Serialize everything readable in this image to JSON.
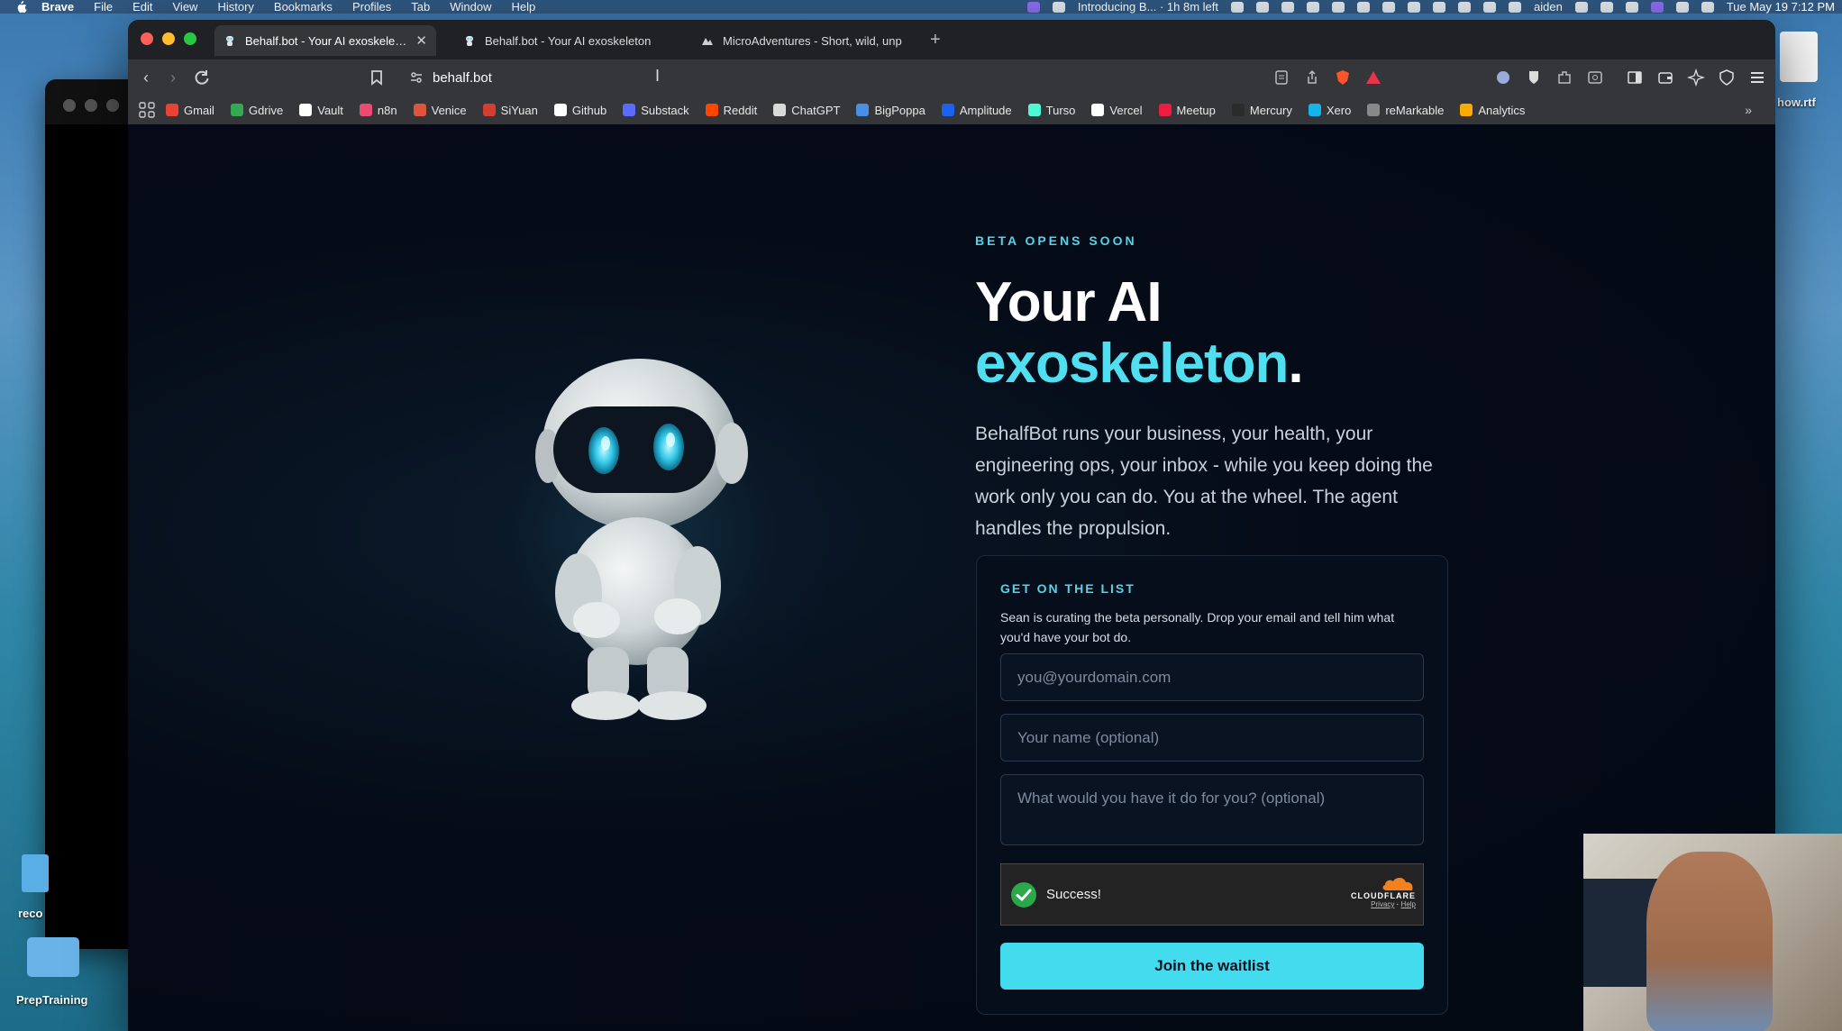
{
  "menubar": {
    "app": "Brave",
    "items": [
      "File",
      "Edit",
      "View",
      "History",
      "Bookmarks",
      "Profiles",
      "Tab",
      "Window",
      "Help"
    ],
    "meeting": "Introducing B... · 1h 8m left",
    "user": "aiden",
    "clock": "Tue May 19  7:12 PM"
  },
  "desktop": {
    "file_label": "how.rtf",
    "folder_label": "PrepTraining",
    "small_label": "reco"
  },
  "browser": {
    "tabs": [
      {
        "title": "Behalf.bot - Your AI exoskeleton",
        "active": true
      },
      {
        "title": "Behalf.bot - Your AI exoskeleton",
        "active": false
      },
      {
        "title": "MicroAdventures - Short, wild, unp",
        "active": false
      }
    ],
    "new_tab": "+",
    "url": "behalf.bot",
    "bookmarks": [
      {
        "label": "Gmail",
        "color": "#ea4335"
      },
      {
        "label": "Gdrive",
        "color": "#34a853"
      },
      {
        "label": "Vault",
        "color": "#ffffff"
      },
      {
        "label": "n8n",
        "color": "#ea4b71"
      },
      {
        "label": "Venice",
        "color": "#e0533d"
      },
      {
        "label": "SiYuan",
        "color": "#d23f31"
      },
      {
        "label": "Github",
        "color": "#ffffff"
      },
      {
        "label": "Substack",
        "color": "#5b6bff"
      },
      {
        "label": "Reddit",
        "color": "#ff4500"
      },
      {
        "label": "ChatGPT",
        "color": "#d9d9d9"
      },
      {
        "label": "BigPoppa",
        "color": "#4a90e2"
      },
      {
        "label": "Amplitude",
        "color": "#1e61f0"
      },
      {
        "label": "Turso",
        "color": "#4ff8d2"
      },
      {
        "label": "Vercel",
        "color": "#ffffff"
      },
      {
        "label": "Meetup",
        "color": "#ed1c40"
      },
      {
        "label": "Mercury",
        "color": "#2b2b2b"
      },
      {
        "label": "Xero",
        "color": "#13b5ea"
      },
      {
        "label": "reMarkable",
        "color": "#888888"
      },
      {
        "label": "Analytics",
        "color": "#f9ab00"
      }
    ],
    "bookmarks_more": "»"
  },
  "hero": {
    "eyebrow": "BETA OPENS SOON",
    "title_line1": "Your AI",
    "title_line2": "exoskeleton",
    "title_period": ".",
    "lede": "BehalfBot runs your business, your health, your engineering ops, your inbox - while you keep doing the work only you can do. You at the wheel. The agent handles the propulsion."
  },
  "signup": {
    "eyebrow": "GET ON THE LIST",
    "description": "Sean is curating the beta personally. Drop your email and tell him what you'd have your bot do.",
    "email_placeholder": "you@yourdomain.com",
    "name_placeholder": "Your name (optional)",
    "task_placeholder": "What would you have it do for you? (optional)",
    "captcha_status": "Success!",
    "captcha_brand": "CLOUDFLARE",
    "captcha_privacy": "Privacy",
    "captcha_sep": "·",
    "captcha_help": "Help",
    "submit_label": "Join the waitlist"
  },
  "colors": {
    "accent": "#43dcef",
    "page_bg": "#050b17",
    "card_border": "#1d2a3c"
  }
}
